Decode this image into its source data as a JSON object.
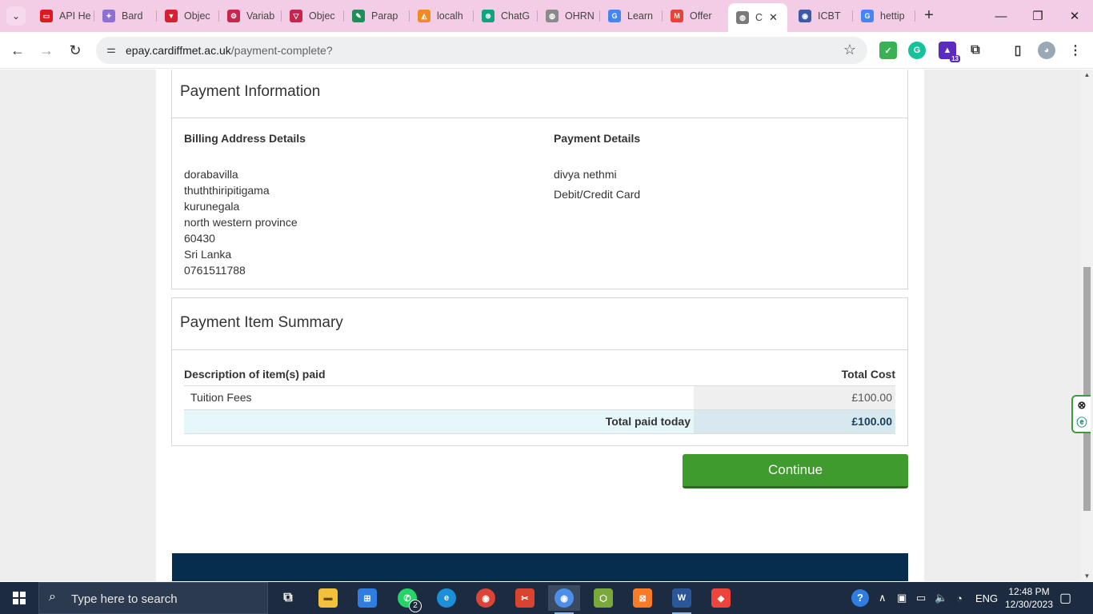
{
  "browser": {
    "tabs": [
      {
        "title": "API He",
        "color": "#e0191f",
        "glyph": "▭"
      },
      {
        "title": "Bard",
        "color": "#8e6fd3",
        "glyph": "✦"
      },
      {
        "title": "Objec",
        "color": "#d62030",
        "glyph": "▼"
      },
      {
        "title": "Variab",
        "color": "#c7254e",
        "glyph": "⚙"
      },
      {
        "title": "Objec",
        "color": "#c7254e",
        "glyph": "▽"
      },
      {
        "title": "Parap",
        "color": "#1e8e5a",
        "glyph": "✎"
      },
      {
        "title": "localh",
        "color": "#f08a24",
        "glyph": "◭"
      },
      {
        "title": "ChatG",
        "color": "#10a37f",
        "glyph": "⊛"
      },
      {
        "title": "OHRN",
        "color": "#8a8a8a",
        "glyph": "◍"
      },
      {
        "title": "Learn",
        "color": "#4285f4",
        "glyph": "G"
      },
      {
        "title": "Offer",
        "color": "#ea4335",
        "glyph": "M"
      },
      {
        "title": "C",
        "color": "#7a7a7a",
        "glyph": "◍",
        "active": true
      },
      {
        "title": "ICBT",
        "color": "#3a5aa8",
        "glyph": "◉"
      },
      {
        "title": "hettip",
        "color": "#4285f4",
        "glyph": "G"
      }
    ],
    "url_host": "epay.cardiffmet.ac.uk",
    "url_path": "/payment-complete?",
    "extension_badge": "13"
  },
  "payment_info": {
    "heading": "Payment Information",
    "billing_title": "Billing Address Details",
    "address_lines": [
      "dorabavilla",
      "thuththiripitigama",
      "kurunegala",
      "north western province",
      "60430",
      "Sri Lanka",
      "0761511788"
    ],
    "details_title": "Payment Details",
    "payer_name": "divya nethmi",
    "method": "Debit/Credit Card"
  },
  "summary": {
    "heading": "Payment Item Summary",
    "col_description": "Description of item(s) paid",
    "col_cost": "Total Cost",
    "items": [
      {
        "description": "Tuition Fees",
        "cost": "£100.00"
      }
    ],
    "total_label": "Total paid today",
    "total_value": "£100.00"
  },
  "continue_label": "Continue",
  "taskbar": {
    "search_placeholder": "Type here to search",
    "whatsapp_badge": "2",
    "language": "ENG",
    "time": "12:48 PM",
    "date": "12/30/2023"
  }
}
